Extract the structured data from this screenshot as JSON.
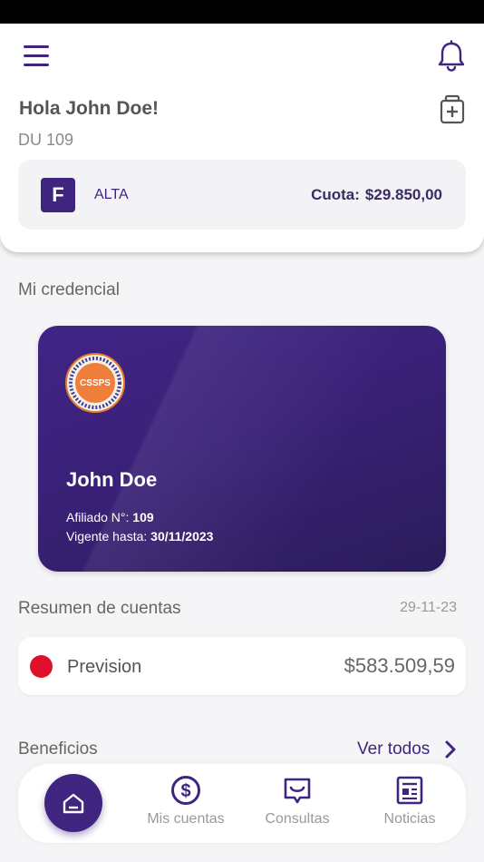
{
  "header": {
    "greeting": "Hola John Doe!",
    "document": "DU 109",
    "plan_letter": "F",
    "plan_status": "ALTA",
    "cuota_label": "Cuota:",
    "cuota_amount": "$29.850,00"
  },
  "credential": {
    "section_title": "Mi credencial",
    "logo_text": "CSSPS",
    "name": "John Doe",
    "afiliado_label": "Afiliado N°:",
    "afiliado_value": "109",
    "vigente_label": "Vigente hasta:",
    "vigente_value": "30/11/2023"
  },
  "resumen": {
    "section_title": "Resumen de cuentas",
    "date": "29-11-23",
    "accounts": [
      {
        "name": "Prevision",
        "amount": "$583.509,59",
        "dot_color": "#e0102d"
      }
    ]
  },
  "beneficios": {
    "section_title": "Beneficios",
    "link": "Ver todos"
  },
  "bottom_nav": {
    "home_icon": "home-icon",
    "items": [
      {
        "label": "Mis cuentas",
        "icon": "dollar-circle-icon"
      },
      {
        "label": "Consultas",
        "icon": "chat-icon"
      },
      {
        "label": "Noticias",
        "icon": "news-icon"
      }
    ]
  },
  "colors": {
    "brand": "#3f2580",
    "status_red": "#e0102d"
  }
}
